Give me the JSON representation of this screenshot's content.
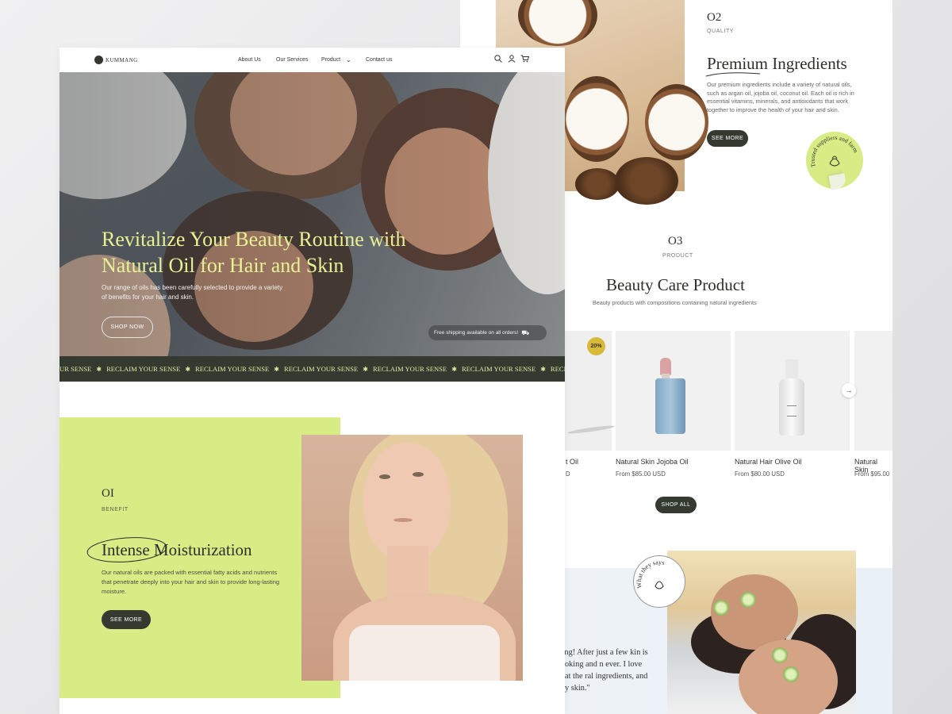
{
  "nav": {
    "logo": "KUMMANG",
    "links": [
      "About Us",
      "Our Services",
      "Product",
      "Contact us"
    ]
  },
  "hero": {
    "title": "Revitalize Your Beauty Routine with Natural Oil for Hair and Skin",
    "subtitle": "Our range of oils has been carefully selected to provide a variety of benefits for your hair and skin.",
    "cta": "SHOP NOW",
    "shipping": "Free shipping available on all orders!"
  },
  "ticker": {
    "lead": "UR SENSE",
    "items": [
      "RECLAIM YOUR SENSE",
      "RECLAIM YOUR SENSE",
      "RECLAIM YOUR SENSE",
      "RECLAIM YOUR SENSE",
      "RECLAIM YOUR SENSE",
      "RECLAIM"
    ]
  },
  "benefit": {
    "number": "OI",
    "label": "BENEFIT",
    "title": "Intense Moisturization",
    "body": "Our natural oils are packed with essential fatty acids and nutrients that penetrate deeply into your hair and skin to provide long-lasting moisture.",
    "cta": "SEE MORE"
  },
  "quality": {
    "number": "O2",
    "label": "QUALITY",
    "title": "Premium Ingredients",
    "body": "Our premium ingredients include a variety of natural oils, such as argan oil, jojoba oil, coconut oil. Each oil is rich in essential vitamins, minerals, and antioxidants that work together to improve the health of your hair and skin.",
    "cta": "SEE MORE",
    "sticker": "Trusted suppliers and farm"
  },
  "product": {
    "number": "O3",
    "label": "PRODUCT",
    "title": "Beauty Care Product",
    "subtitle": "Beauty products with compositions containing natural ingredients",
    "badge": "20%",
    "items": [
      {
        "name": "t Oil",
        "price": "D"
      },
      {
        "name": "Natural Skin Jojoba Oil",
        "price": "From $85.00 USD"
      },
      {
        "name": "Natural Hair Olive Oil",
        "price": "From $80.00 USD"
      },
      {
        "name": "Natural Skin",
        "price": "From $95.00"
      }
    ],
    "cta": "SHOP ALL"
  },
  "testimonial": {
    "stamp": "What they says",
    "quote": "zing! After just a few kin is looking and n ever. I love that the ral ingredients, and my skin.\""
  },
  "colors": {
    "accent": "#d8ec86",
    "dark": "#353a30",
    "hero_title": "#e8f193",
    "badge": "#d8ba3a"
  }
}
